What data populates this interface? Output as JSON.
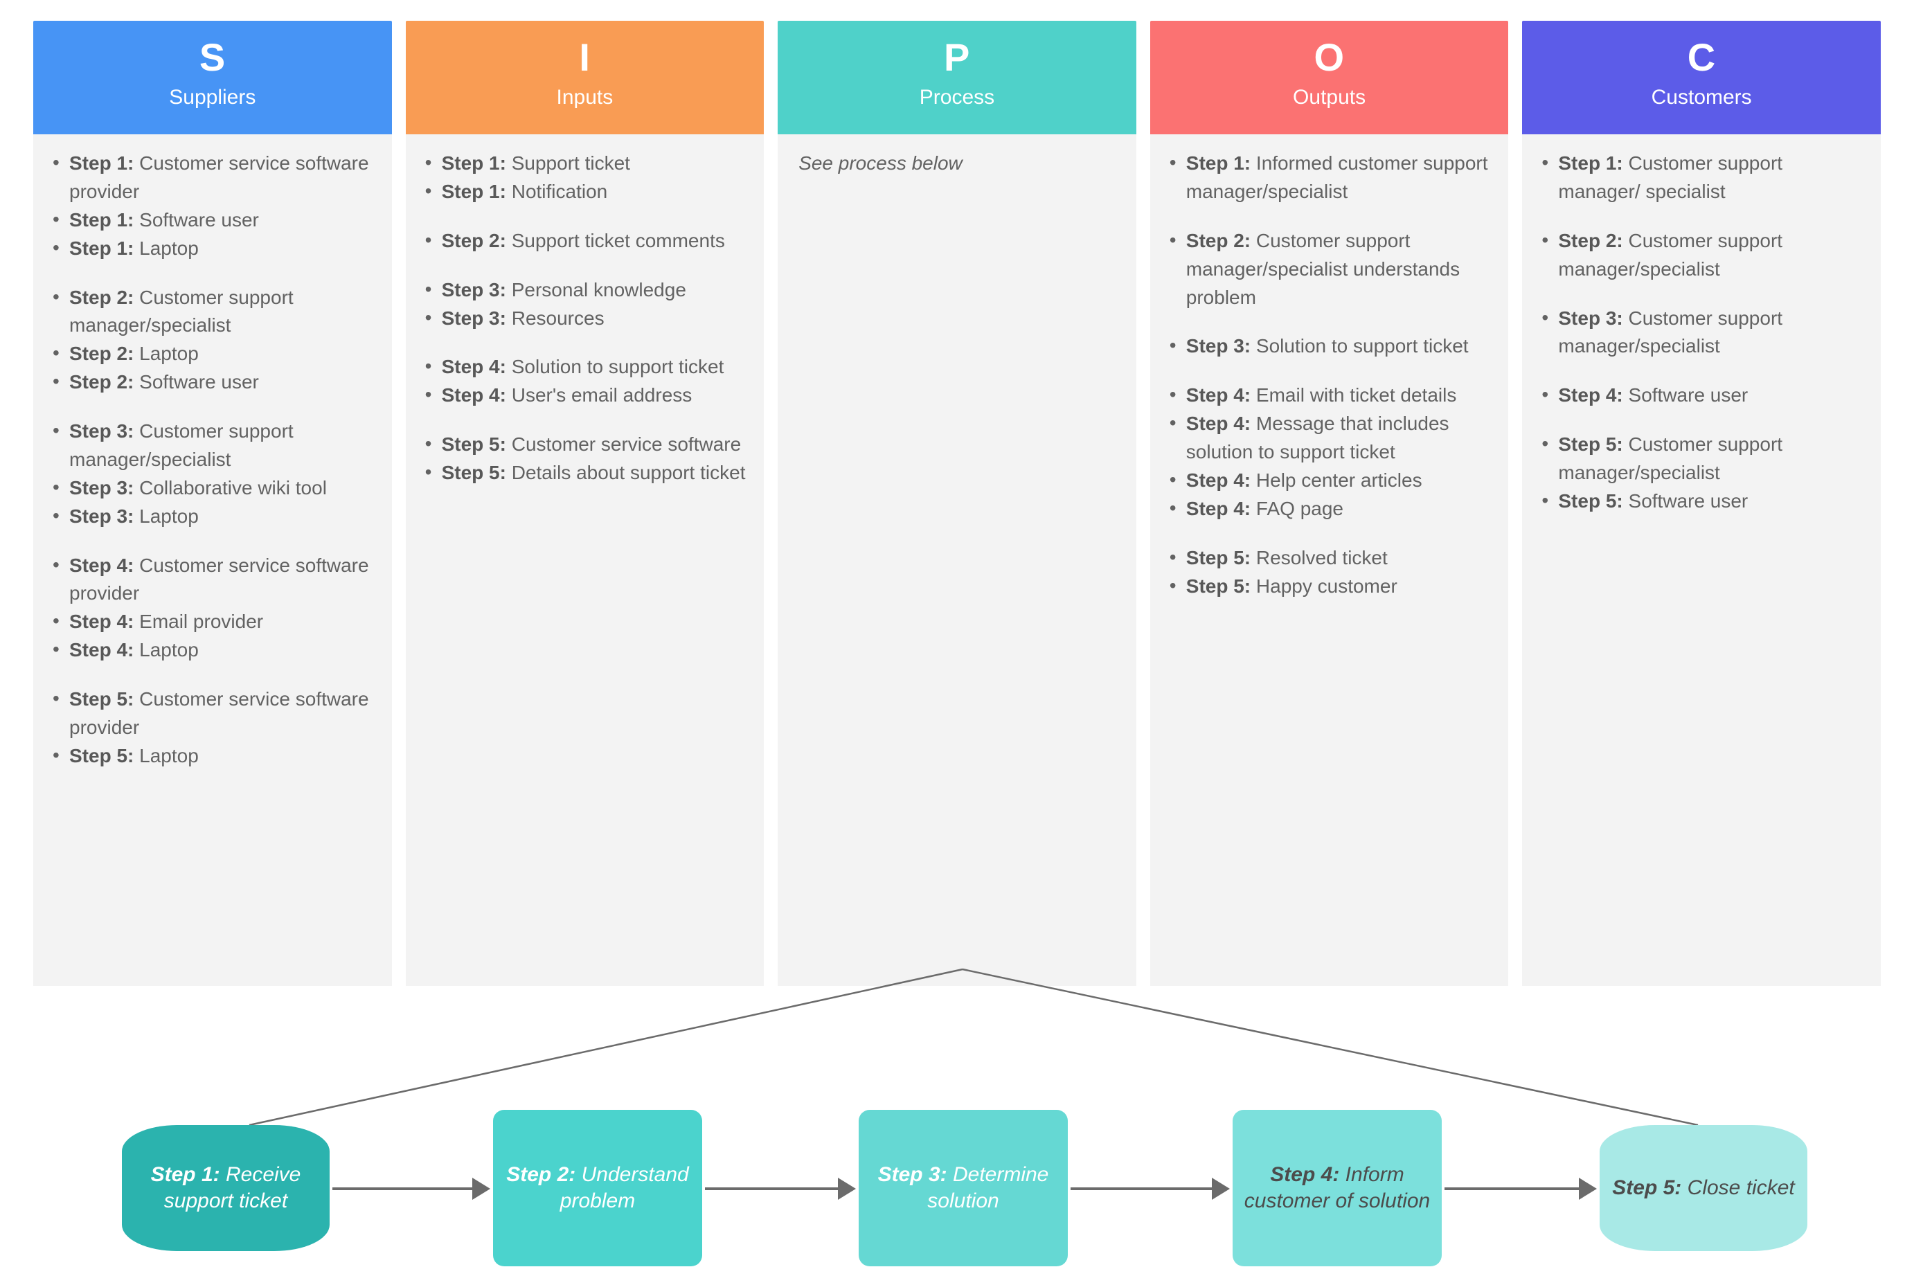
{
  "columns": [
    {
      "letter": "S",
      "name": "Suppliers",
      "color": "#4794f5",
      "items": [
        {
          "step": "Step 1:",
          "text": " Customer service software provider"
        },
        {
          "step": "Step 1:",
          "text": " Software user"
        },
        {
          "step": "Step 1:",
          "text": " Laptop"
        },
        {
          "spacer": true
        },
        {
          "step": "Step 2:",
          "text": " Customer support manager/specialist"
        },
        {
          "step": "Step 2:",
          "text": " Laptop"
        },
        {
          "step": "Step 2:",
          "text": " Software user"
        },
        {
          "spacer": true
        },
        {
          "step": "Step 3:",
          "text": " Customer support manager/specialist"
        },
        {
          "step": "Step 3:",
          "text": " Collaborative wiki tool"
        },
        {
          "step": "Step 3:",
          "text": " Laptop"
        },
        {
          "spacer": true
        },
        {
          "step": "Step 4:",
          "text": " Customer service software provider"
        },
        {
          "step": "Step 4:",
          "text": " Email provider"
        },
        {
          "step": "Step 4:",
          "text": " Laptop"
        },
        {
          "spacer": true
        },
        {
          "step": "Step 5:",
          "text": " Customer service software provider"
        },
        {
          "step": "Step 5:",
          "text": " Laptop"
        }
      ]
    },
    {
      "letter": "I",
      "name": "Inputs",
      "color": "#f99c54",
      "items": [
        {
          "step": "Step 1:",
          "text": " Support ticket"
        },
        {
          "step": "Step 1:",
          "text": " Notification"
        },
        {
          "spacer": true
        },
        {
          "step": "Step 2:",
          "text": " Support ticket comments"
        },
        {
          "spacer": true
        },
        {
          "step": "Step 3:",
          "text": " Personal knowledge"
        },
        {
          "step": "Step 3:",
          "text": " Resources"
        },
        {
          "spacer": true
        },
        {
          "step": "Step 4:",
          "text": " Solution to support ticket"
        },
        {
          "step": "Step 4:",
          "text": " User's email address"
        },
        {
          "spacer": true
        },
        {
          "step": "Step 5:",
          "text": " Customer service software"
        },
        {
          "step": "Step 5:",
          "text": " Details about support ticket"
        }
      ]
    },
    {
      "letter": "P",
      "name": "Process",
      "color": "#4fd1c9",
      "note": "See process below",
      "items": []
    },
    {
      "letter": "O",
      "name": "Outputs",
      "color": "#fb7272",
      "items": [
        {
          "step": "Step 1:",
          "text": " Informed customer support manager/specialist"
        },
        {
          "spacer": true
        },
        {
          "step": "Step 2:",
          "text": " Customer support manager/specialist understands problem"
        },
        {
          "spacer": true
        },
        {
          "step": "Step 3:",
          "text": " Solution to support ticket"
        },
        {
          "spacer": true
        },
        {
          "step": "Step 4:",
          "text": " Email with ticket details"
        },
        {
          "step": "Step 4:",
          "text": " Message that includes solution to support ticket"
        },
        {
          "step": "Step 4:",
          "text": " Help center articles"
        },
        {
          "step": "Step 4:",
          "text": " FAQ page"
        },
        {
          "spacer": true
        },
        {
          "step": "Step 5:",
          "text": " Resolved ticket"
        },
        {
          "step": "Step 5:",
          "text": " Happy customer"
        }
      ]
    },
    {
      "letter": "C",
      "name": "Customers",
      "color": "#5c5ce8",
      "items": [
        {
          "step": "Step 1:",
          "text": " Customer support manager/ specialist"
        },
        {
          "spacer": true
        },
        {
          "step": "Step 2:",
          "text": " Customer support manager/specialist"
        },
        {
          "spacer": true
        },
        {
          "step": "Step 3:",
          "text": " Customer support manager/specialist"
        },
        {
          "spacer": true
        },
        {
          "step": "Step 4:",
          "text": " Software user"
        },
        {
          "spacer": true
        },
        {
          "step": "Step 5:",
          "text": " Customer support manager/specialist"
        },
        {
          "step": "Step 5:",
          "text": " Software user"
        }
      ]
    }
  ],
  "flow": {
    "nodes": [
      {
        "label": "Step 1:",
        "text": "Receive support ticket",
        "color": "#2bb3ae",
        "shape": "cyl",
        "text_color": "#ffffff"
      },
      {
        "label": "Step 2:",
        "text": "Understand problem",
        "color": "#4bd3cd",
        "shape": "rect",
        "text_color": "#ffffff"
      },
      {
        "label": "Step 3:",
        "text": "Determine solution",
        "color": "#65d8d3",
        "shape": "rect",
        "text_color": "#ffffff"
      },
      {
        "label": "Step 4:",
        "text": "Inform customer of solution",
        "color": "#7ce0dc",
        "shape": "rect",
        "text_color": "#4c4c4c"
      },
      {
        "label": "Step 5:",
        "text": "Close ticket",
        "color": "#a8e9e6",
        "shape": "cyl",
        "text_color": "#4c4c4c"
      }
    ],
    "arrow_color": "#6b6b6b",
    "connector_color": "#6b6b6b"
  }
}
